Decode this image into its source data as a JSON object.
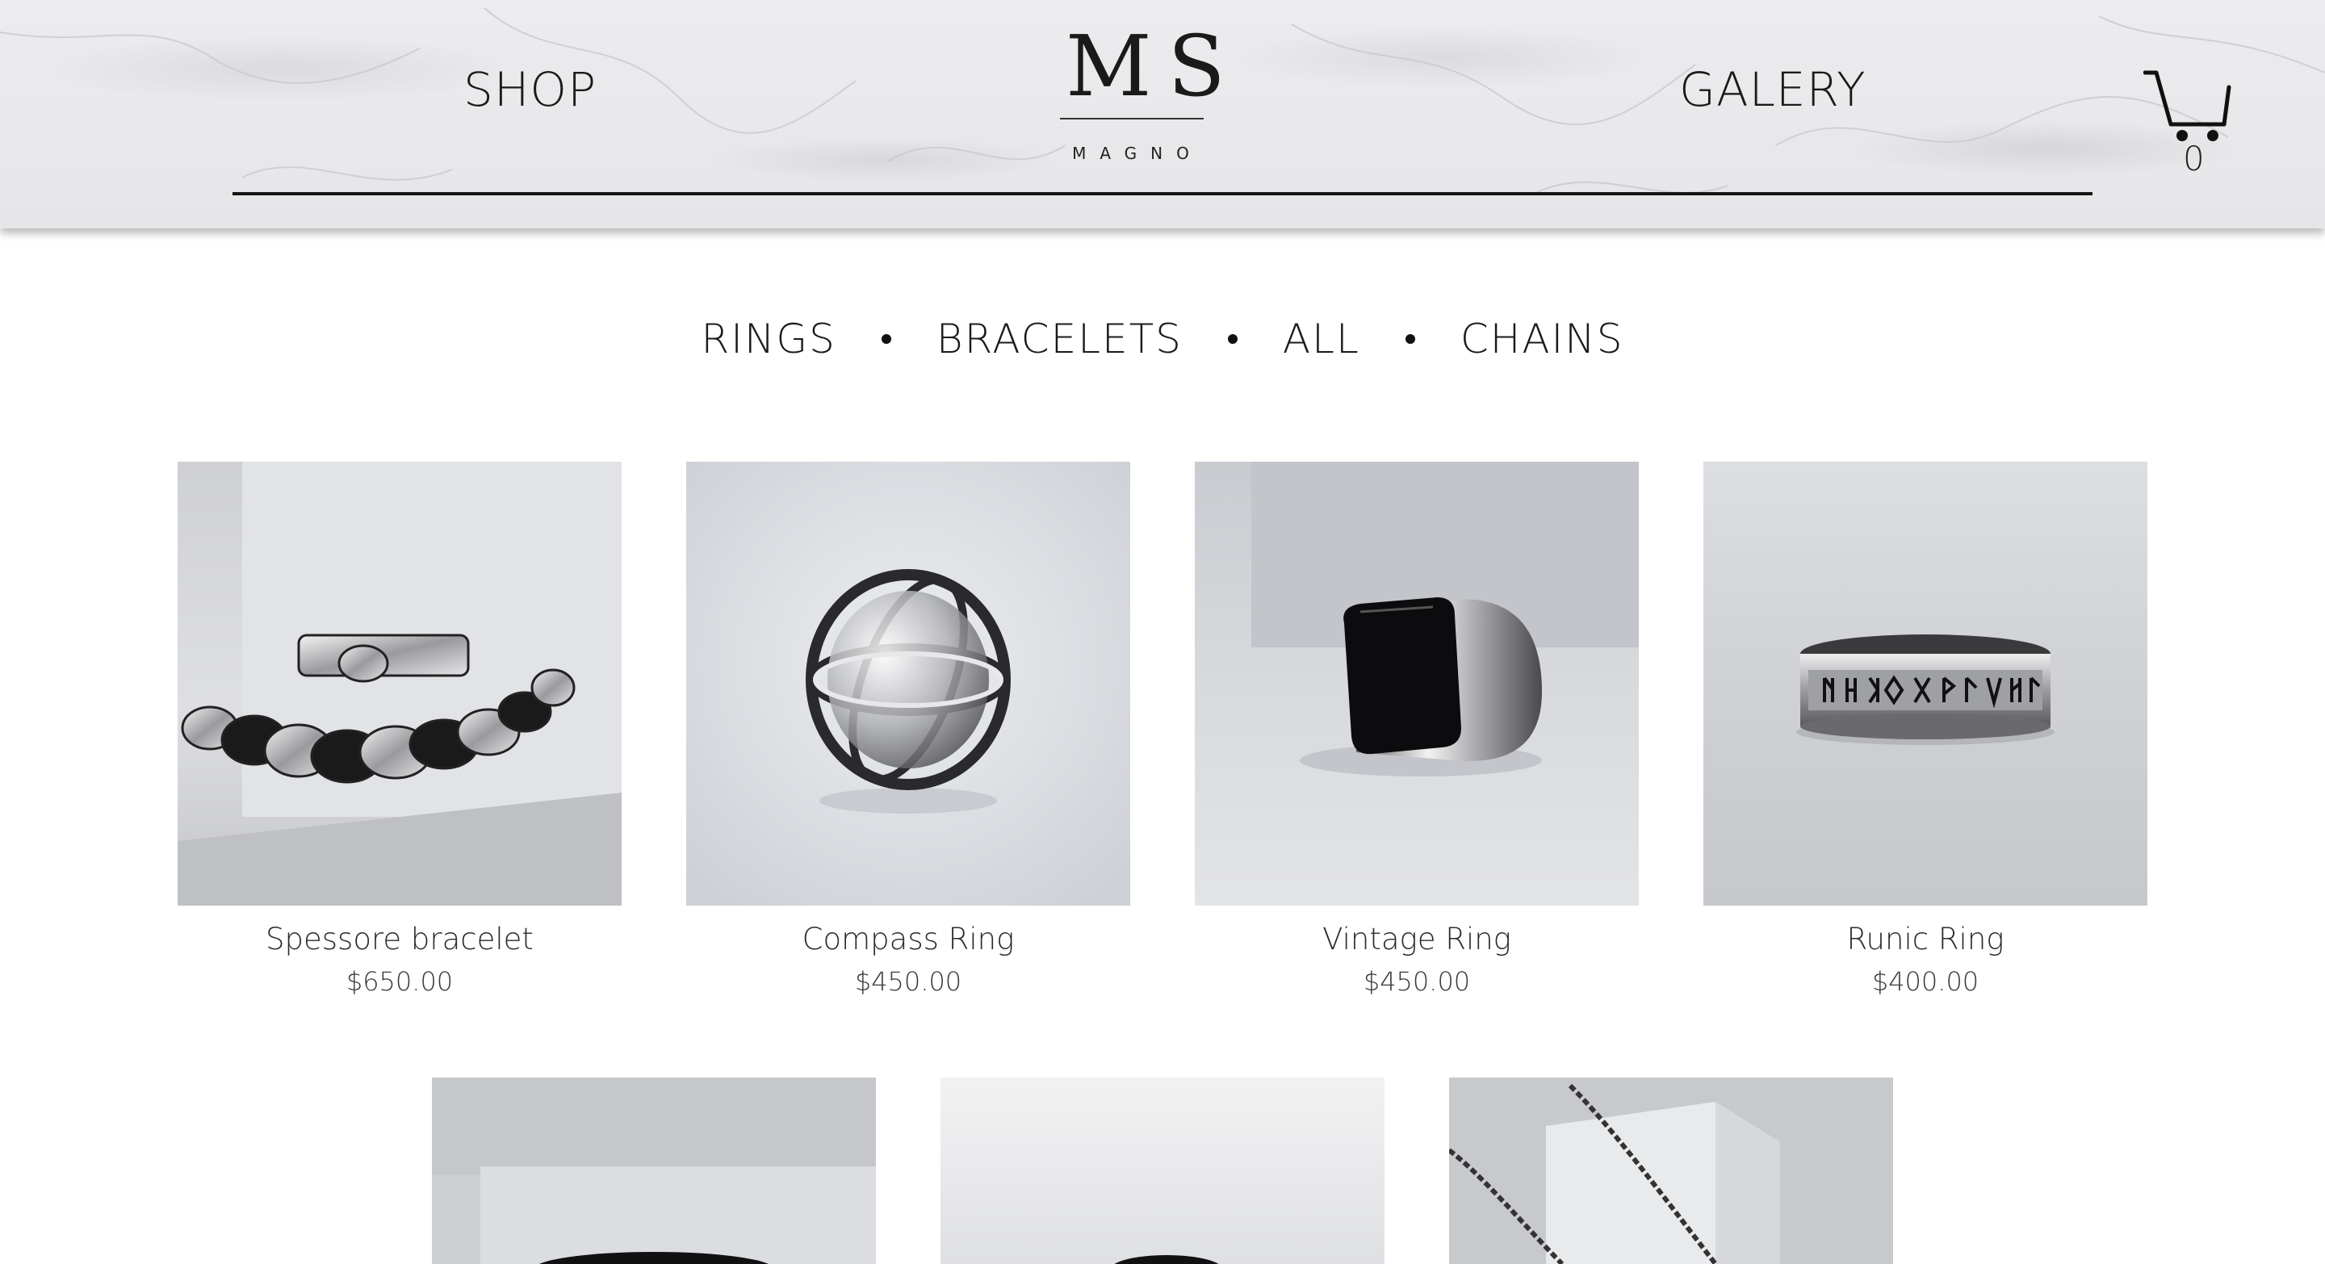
{
  "header": {
    "nav_left": "SHOP",
    "nav_right": "GALERY",
    "logo_mark": "MS",
    "logo_sub": "MAGNO",
    "cart_icon": "cart-icon",
    "cart_count": "0"
  },
  "categories": {
    "items": [
      "RINGS",
      "BRACELETS",
      "ALL",
      "CHAINS"
    ]
  },
  "products": [
    {
      "name": "Spessore bracelet",
      "price": "$650.00",
      "image": "bracelet-photo"
    },
    {
      "name": "Compass Ring",
      "price": "$450.00",
      "image": "compass-ring-photo"
    },
    {
      "name": "Vintage Ring",
      "price": "$450.00",
      "image": "signet-ring-photo"
    },
    {
      "name": "Runic Ring",
      "price": "$400.00",
      "image": "runic-ring-photo"
    },
    {
      "name": "",
      "price": "",
      "image": "ring-photo"
    },
    {
      "name": "",
      "price": "",
      "image": "ring-photo"
    },
    {
      "name": "",
      "price": "",
      "image": "chain-photo"
    }
  ],
  "colors": {
    "header_bg": "#e8e8ea",
    "text": "#1a1a1a",
    "rule": "#151515",
    "photo_bg": "#d9dadf"
  }
}
